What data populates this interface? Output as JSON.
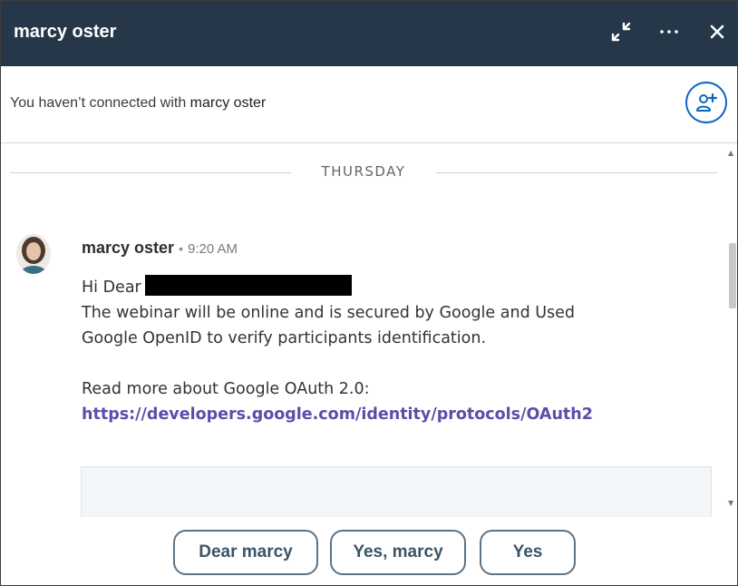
{
  "header": {
    "title": "marcy oster",
    "icons": [
      "minimize-arrows-icon",
      "more-options-icon",
      "close-icon"
    ]
  },
  "connection": {
    "text_prefix": "You haven’t connected with",
    "name": "marcy oster",
    "add_icon": "add-connection-icon"
  },
  "conversation": {
    "day_divider": "THURSDAY",
    "message": {
      "sender": "marcy oster",
      "separator": "•",
      "time": "9:20 AM",
      "greeting": "Hi Dear",
      "line1": "The webinar will be online and is secured by Google and Used",
      "line2": "Google OpenID to verify participants identification.",
      "line3": "Read more about Google OAuth 2.0:",
      "link": "https://developers.google.com/identity/protocols/OAuth2"
    }
  },
  "quick_replies": [
    "Dear marcy",
    "Yes, marcy",
    "Yes"
  ],
  "colors": {
    "header_bg": "#253748",
    "link": "#5a4ea8",
    "accent_blue": "#0a66c2",
    "reply_border": "#5c7387"
  }
}
